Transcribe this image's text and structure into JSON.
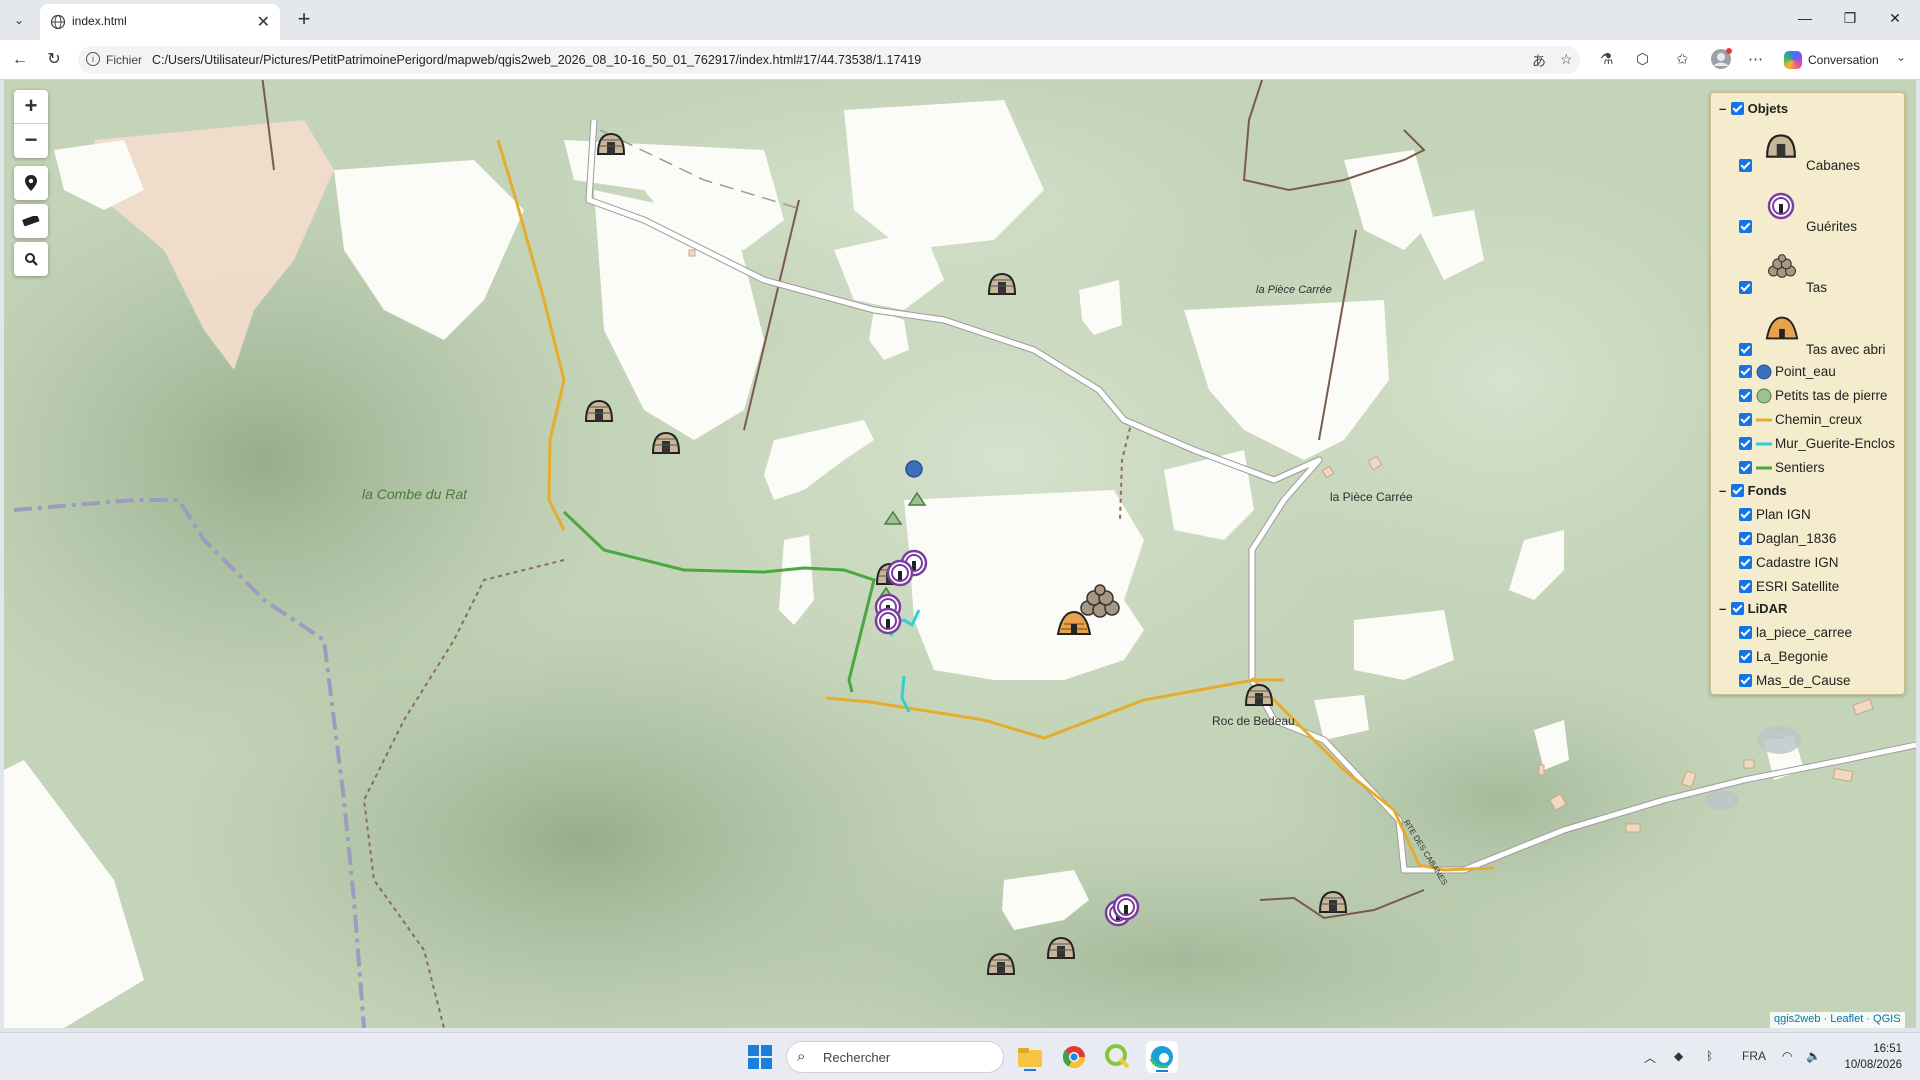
{
  "browser": {
    "tab_title": "index.html",
    "address_prefix": "Fichier",
    "address_path": "C:/Users/Utilisateur/Pictures/PetitPatrimoinePerigord/mapweb/qgis2web_2026_08_10-16_50_01_762917/index.html#17/44.73538/1.17419",
    "copilot_label": "Conversation"
  },
  "map": {
    "labels": {
      "combe": "la Combe du Rat",
      "piece_carree_italic": "la Pièce Carrée",
      "piece_carree": "la Pièce Carrée",
      "roc": "Roc de Bedeau",
      "road": "RTE DES CABANES"
    },
    "attribution": "qgis2web · Leaflet · QGIS",
    "colors": {
      "chemin_creux": "#e5ac2e",
      "sentiers": "#4aa83f",
      "mur": "#2ed0d8",
      "point_eau": "#3d6fbf",
      "guerite": "#7a3e9e"
    }
  },
  "legend": {
    "groups": [
      {
        "title": "Objets"
      },
      {
        "title": "Fonds"
      },
      {
        "title": "LiDAR"
      }
    ],
    "objets": [
      "Cabanes",
      "Guérites",
      "Tas",
      "Tas avec abri",
      "Point_eau",
      "Petits tas de pierre",
      "Chemin_creux",
      "Mur_Guerite-Enclos",
      "Sentiers"
    ],
    "fonds": [
      "Plan IGN",
      "Daglan_1836",
      "Cadastre IGN",
      "ESRI Satellite"
    ],
    "lidar": [
      "la_piece_carree",
      "La_Begonie",
      "Mas_de_Cause"
    ]
  },
  "taskbar": {
    "search_placeholder": "Rechercher",
    "lang": "FRA",
    "time": "16:51",
    "date": "10/08/2026"
  }
}
